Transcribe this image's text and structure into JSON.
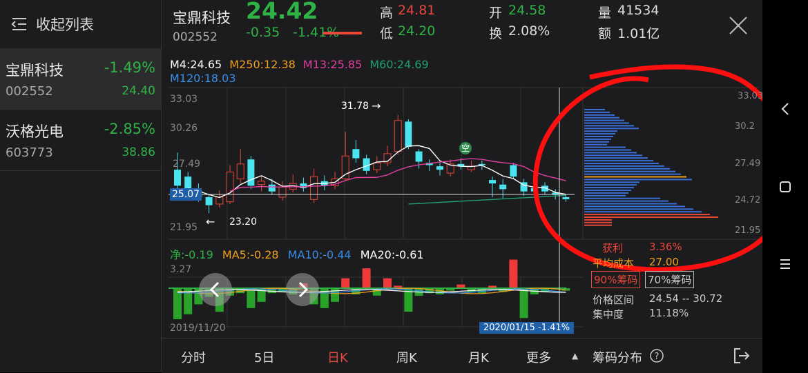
{
  "sidebar": {
    "collapse_label": "收起列表",
    "items": [
      {
        "name": "宝鼎科技",
        "change": "-1.49%",
        "code": "002552",
        "price": "24.40"
      },
      {
        "name": "沃格光电",
        "change": "-2.85%",
        "code": "603773",
        "price": "38.86"
      }
    ]
  },
  "quote": {
    "name": "宝鼎科技",
    "code": "002552",
    "price": "24.42",
    "change": "-0.35",
    "change_pct": "-1.41%",
    "high_label": "高",
    "high": "24.81",
    "low_label": "低",
    "low": "24.20",
    "open_label": "开",
    "open": "24.58",
    "turnover_label": "换",
    "turnover": "2.08%",
    "volume_label": "量",
    "volume": "41534",
    "amount_label": "额",
    "amount": "1.01亿"
  },
  "ma_legend": {
    "ma4": "M4:24.65",
    "ma250": "M250:12.38",
    "ma13": "M13:25.85",
    "ma60": "M60:24.69",
    "ma120": "M120:18.03"
  },
  "price_axis": {
    "left_labels": [
      "33.03",
      "30.26",
      "27.49",
      "21.95"
    ],
    "right_labels": [
      "33.03",
      "30.2",
      "27.49",
      "24.72",
      "21.95"
    ],
    "current_price_tag": "25.07"
  },
  "annotations": {
    "high_mark": "31.78",
    "low_mark": "23.20",
    "chip_label": "空"
  },
  "macd": {
    "net": "净:-0.19",
    "ma5": "MA5:-0.28",
    "ma10": "MA10:-0.44",
    "ma20": "MA20:-0.61",
    "top_label": "3.27",
    "start_date": "2019/11/20",
    "cursor_tag": "2020/01/15  -1.41%"
  },
  "chips": {
    "profit_label": "获利",
    "profit_value": "3.36%",
    "avg_cost_label": "平均成本",
    "avg_cost_value": "27.00",
    "btn_90": "90%筹码",
    "btn_70": "70%筹码",
    "range_label": "价格区间",
    "range_value": "24.54 -- 30.72",
    "concentration_label": "集中度",
    "concentration_value": "11.18%"
  },
  "tabs": [
    "分时",
    "5日",
    "日K",
    "周K",
    "月K",
    "更多"
  ],
  "active_tab": "日K",
  "chip_dist_label": "筹码分布",
  "colors": {
    "up": "#e8473b",
    "down": "#2fb344",
    "candle_down": "#4be3f0",
    "ma4": "#ffffff",
    "ma250": "#f0a020",
    "ma13": "#e040a0",
    "ma60": "#20a070",
    "ma120": "#3a8ee6",
    "annotation_circle": "#ff1010"
  },
  "chart_data": [
    {
      "type": "candlestick",
      "title": "",
      "ylim": [
        21.95,
        33.03
      ],
      "x_start": "2019/11/20",
      "x_end": "2020/01/15",
      "candles": [
        {
          "o": 27.0,
          "c": 25.6,
          "h": 28.5,
          "l": 25.2
        },
        {
          "o": 26.4,
          "c": 25.2,
          "h": 26.8,
          "l": 24.8
        },
        {
          "o": 25.2,
          "c": 24.6,
          "h": 25.8,
          "l": 24.2
        },
        {
          "o": 24.6,
          "c": 23.9,
          "h": 24.9,
          "l": 23.2
        },
        {
          "o": 24.0,
          "c": 24.6,
          "h": 25.2,
          "l": 23.7
        },
        {
          "o": 24.2,
          "c": 26.8,
          "h": 27.4,
          "l": 24.0
        },
        {
          "o": 26.2,
          "c": 27.5,
          "h": 28.8,
          "l": 25.8
        },
        {
          "o": 27.9,
          "c": 25.6,
          "h": 28.2,
          "l": 25.3
        },
        {
          "o": 25.7,
          "c": 26.0,
          "h": 26.4,
          "l": 25.1
        },
        {
          "o": 25.7,
          "c": 25.1,
          "h": 26.2,
          "l": 24.8
        },
        {
          "o": 24.6,
          "c": 25.5,
          "h": 26.0,
          "l": 24.3
        },
        {
          "o": 25.3,
          "c": 25.8,
          "h": 26.6,
          "l": 25.0
        },
        {
          "o": 25.8,
          "c": 25.4,
          "h": 26.3,
          "l": 25.1
        },
        {
          "o": 24.4,
          "c": 26.4,
          "h": 27.1,
          "l": 24.1
        },
        {
          "o": 26.0,
          "c": 25.6,
          "h": 26.5,
          "l": 25.2
        },
        {
          "o": 25.6,
          "c": 26.2,
          "h": 26.8,
          "l": 25.3
        },
        {
          "o": 26.2,
          "c": 28.2,
          "h": 30.3,
          "l": 26.0
        },
        {
          "o": 28.8,
          "c": 28.0,
          "h": 29.6,
          "l": 27.6
        },
        {
          "o": 28.0,
          "c": 26.9,
          "h": 28.3,
          "l": 26.6
        },
        {
          "o": 27.0,
          "c": 27.6,
          "h": 28.2,
          "l": 26.7
        },
        {
          "o": 27.6,
          "c": 28.4,
          "h": 29.1,
          "l": 27.3
        },
        {
          "o": 28.6,
          "c": 31.3,
          "h": 31.78,
          "l": 28.3
        },
        {
          "o": 31.2,
          "c": 29.0,
          "h": 31.4,
          "l": 28.8
        },
        {
          "o": 28.6,
          "c": 27.7,
          "h": 28.8,
          "l": 27.1
        },
        {
          "o": 27.6,
          "c": 27.4,
          "h": 27.9,
          "l": 26.9
        },
        {
          "o": 27.3,
          "c": 27.0,
          "h": 27.6,
          "l": 26.5
        },
        {
          "o": 26.7,
          "c": 27.5,
          "h": 27.9,
          "l": 26.4
        },
        {
          "o": 27.5,
          "c": 27.3,
          "h": 28.0,
          "l": 27.0
        },
        {
          "o": 27.0,
          "c": 27.3,
          "h": 27.8,
          "l": 26.8
        },
        {
          "o": 27.5,
          "c": 27.4,
          "h": 27.8,
          "l": 27.0
        },
        {
          "o": 26.1,
          "c": 25.8,
          "h": 26.4,
          "l": 24.6
        },
        {
          "o": 25.7,
          "c": 25.3,
          "h": 26.2,
          "l": 24.5
        },
        {
          "o": 27.4,
          "c": 26.4,
          "h": 27.6,
          "l": 26.2
        },
        {
          "o": 25.9,
          "c": 25.1,
          "h": 26.2,
          "l": 24.7
        },
        {
          "o": 25.4,
          "c": 25.1,
          "h": 25.6,
          "l": 24.8
        },
        {
          "o": 25.6,
          "c": 25.1,
          "h": 25.9,
          "l": 24.8
        },
        {
          "o": 25.0,
          "c": 24.8,
          "h": 25.3,
          "l": 24.4
        },
        {
          "o": 24.6,
          "c": 24.42,
          "h": 24.81,
          "l": 24.2
        }
      ]
    },
    {
      "type": "bar",
      "title": "",
      "description_series": "net",
      "values": [
        -2.5,
        -2.1,
        -1.3,
        -0.7,
        -1.9,
        -0.6,
        -0.4,
        -1.6,
        -1.1,
        -0.4,
        -0.3,
        -0.5,
        0.4,
        -1.3,
        -1.6,
        -1.1,
        0.8,
        -0.5,
        1.6,
        -0.6,
        0.8,
        0.2,
        -1.9,
        -0.6,
        -0.4,
        -0.5,
        -0.2,
        0.3,
        -0.3,
        -0.4,
        0.2,
        -0.3,
        2.3,
        -2.4,
        -0.5,
        -0.3,
        -0.1,
        -0.2
      ],
      "ylim": [
        -2.6,
        3.27
      ]
    }
  ]
}
